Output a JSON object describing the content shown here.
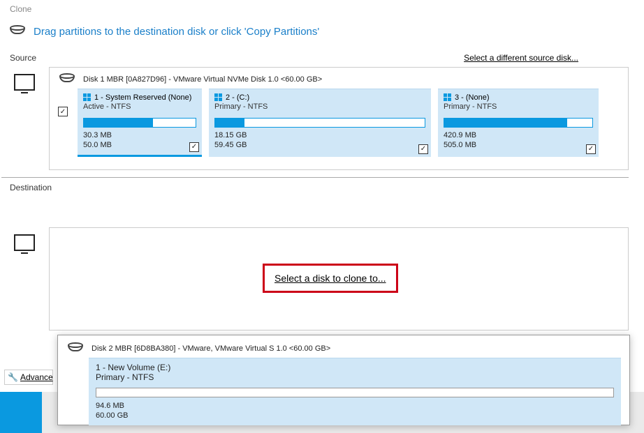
{
  "title": "Clone",
  "instruction": "Drag partitions to the destination disk or click 'Copy Partitions'",
  "source": {
    "label": "Source",
    "different_link": "Select a different source disk...",
    "disk_header": "Disk 1 MBR [0A827D96] - VMware Virtual NVMe Disk 1.0  <60.00 GB>",
    "partitions": [
      {
        "title": "1 - System Reserved (None)",
        "sub": "Active - NTFS",
        "used": "30.3 MB",
        "total": "50.0 MB",
        "checked": true,
        "pcheck": true
      },
      {
        "title": "2 -  (C:)",
        "sub": "Primary - NTFS",
        "used": "18.15 GB",
        "total": "59.45 GB",
        "checked": false,
        "pcheck": true
      },
      {
        "title": "3 -  (None)",
        "sub": "Primary - NTFS",
        "used": "420.9 MB",
        "total": "505.0 MB",
        "checked": false,
        "pcheck": true
      }
    ]
  },
  "destination": {
    "label": "Destination",
    "select_link": "Select a disk to clone to..."
  },
  "popup": {
    "disk_header": "Disk 2 MBR [6D8BA380] - VMware,  VMware Virtual S 1.0  <60.00 GB>",
    "part": {
      "title": "1 - New Volume (E:)",
      "sub": "Primary - NTFS",
      "used": "94.6 MB",
      "total": "60.00 GB"
    }
  },
  "advanced_label": "Advance",
  "icons": {
    "disk": "disk-icon",
    "monitor": "monitor-icon",
    "windows": "windows-logo",
    "wrench": "wrench-icon"
  }
}
